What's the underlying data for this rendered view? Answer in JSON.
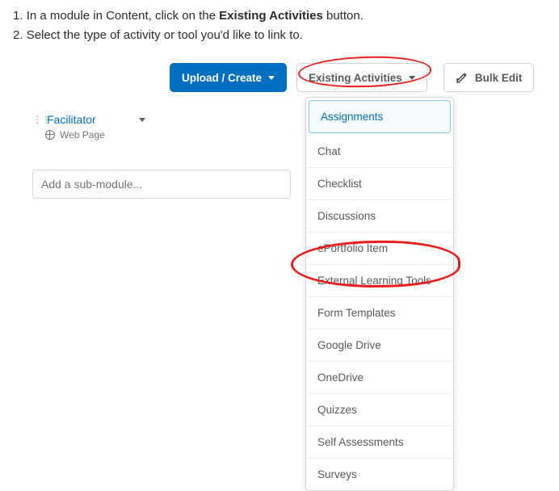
{
  "instructions": {
    "step1_pre": "In a module in Content, click on the ",
    "step1_bold": "Existing Activities",
    "step1_post": " button.",
    "step2": "Select the type of activity or tool you'd like to link to."
  },
  "toolbar": {
    "upload_create": "Upload / Create",
    "existing_activities": "Existing Activities",
    "bulk_edit": "Bulk Edit"
  },
  "left": {
    "facilitator": "Facilitator",
    "web_page": "Web Page"
  },
  "sub_module_placeholder": "Add a sub-module...",
  "dropdown": {
    "items": [
      "Assignments",
      "Chat",
      "Checklist",
      "Discussions",
      "ePortfolio Item",
      "External Learning Tools",
      "Form Templates",
      "Google Drive",
      "OneDrive",
      "Quizzes",
      "Self Assessments",
      "Surveys"
    ],
    "selected_index": 0
  }
}
